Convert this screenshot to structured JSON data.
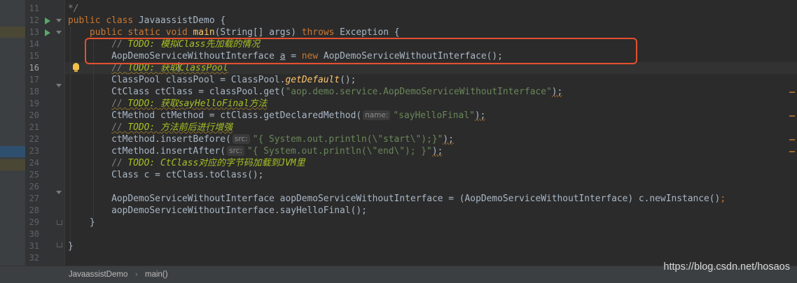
{
  "editor": {
    "file_name": "JavaassistDemo",
    "method_name": "main()",
    "watermark": "https://blog.csdn.net/hosaos",
    "current_line": "16"
  },
  "lines": [
    {
      "no": "11",
      "frag": [
        "*/"
      ]
    },
    {
      "no": "12",
      "frag": [
        "public",
        "class",
        "JavaassistDemo",
        "{"
      ]
    },
    {
      "no": "13",
      "frag": [
        "public",
        "static",
        "void",
        "main",
        "(String[] args)",
        "throws",
        "Exception {"
      ]
    },
    {
      "no": "14",
      "frag": [
        "// ",
        "TODO: ",
        "模拟",
        "Class",
        "先加载的情况"
      ]
    },
    {
      "no": "15",
      "frag": [
        "AopDemoServiceWithoutInterface",
        "a",
        "=",
        "new",
        "AopDemoServiceWithoutInterface",
        "();"
      ]
    },
    {
      "no": "16",
      "frag": [
        "// ",
        "TODO: ",
        "获取",
        "ClassPool"
      ]
    },
    {
      "no": "17",
      "frag": [
        "ClassPool classPool = ClassPool.",
        "getDefault",
        "();"
      ]
    },
    {
      "no": "18",
      "frag": [
        "CtClass ctClass = classPool.get(",
        "\"aop.demo.service.AopDemoServiceWithoutInterface\"",
        ");"
      ]
    },
    {
      "no": "19",
      "frag": [
        "// ",
        "TODO: ",
        "获取",
        "sayHelloFinal",
        "方法"
      ]
    },
    {
      "no": "20",
      "frag": [
        "CtMethod ctMethod = ctClass.getDeclaredMethod(",
        "name:",
        "\"sayHelloFinal\"",
        ");"
      ]
    },
    {
      "no": "21",
      "frag": [
        "// ",
        "TODO: ",
        "方法前后进行增强"
      ]
    },
    {
      "no": "22",
      "frag": [
        "ctMethod.insertBefore(",
        "src:",
        "\"{ System.out.println(\\\"start\\\");}\"",
        ");"
      ]
    },
    {
      "no": "23",
      "frag": [
        "ctMethod.insertAfter(",
        "src:",
        "\"{ System.out.println(\\\"end\\\"); }\"",
        ");"
      ]
    },
    {
      "no": "24",
      "frag": [
        "// ",
        "TODO: ",
        "CtClass",
        "对应的字节码加载到",
        "JVM",
        "里"
      ]
    },
    {
      "no": "25",
      "frag": [
        "Class c = ctClass.toClass();"
      ]
    },
    {
      "no": "26",
      "frag": []
    },
    {
      "no": "27",
      "frag": [
        "AopDemoServiceWithoutInterface aopDemoServiceWithoutInterface = (AopDemoServiceWithoutInterface) c.newInstance()",
        ";"
      ]
    },
    {
      "no": "28",
      "frag": [
        "aopDemoServiceWithoutInterface.sayHelloFinal();"
      ]
    },
    {
      "no": "29",
      "frag": [
        "}"
      ]
    },
    {
      "no": "30",
      "frag": []
    },
    {
      "no": "31",
      "frag": [
        "}"
      ]
    },
    {
      "no": "32",
      "frag": []
    }
  ],
  "colors": {
    "background": "#2b2b2b",
    "keyword": "#cc7832",
    "method": "#ffc66d",
    "string": "#6a8759",
    "comment": "#808080",
    "todo": "#a8c023",
    "highlight_box": "#e4502f"
  }
}
